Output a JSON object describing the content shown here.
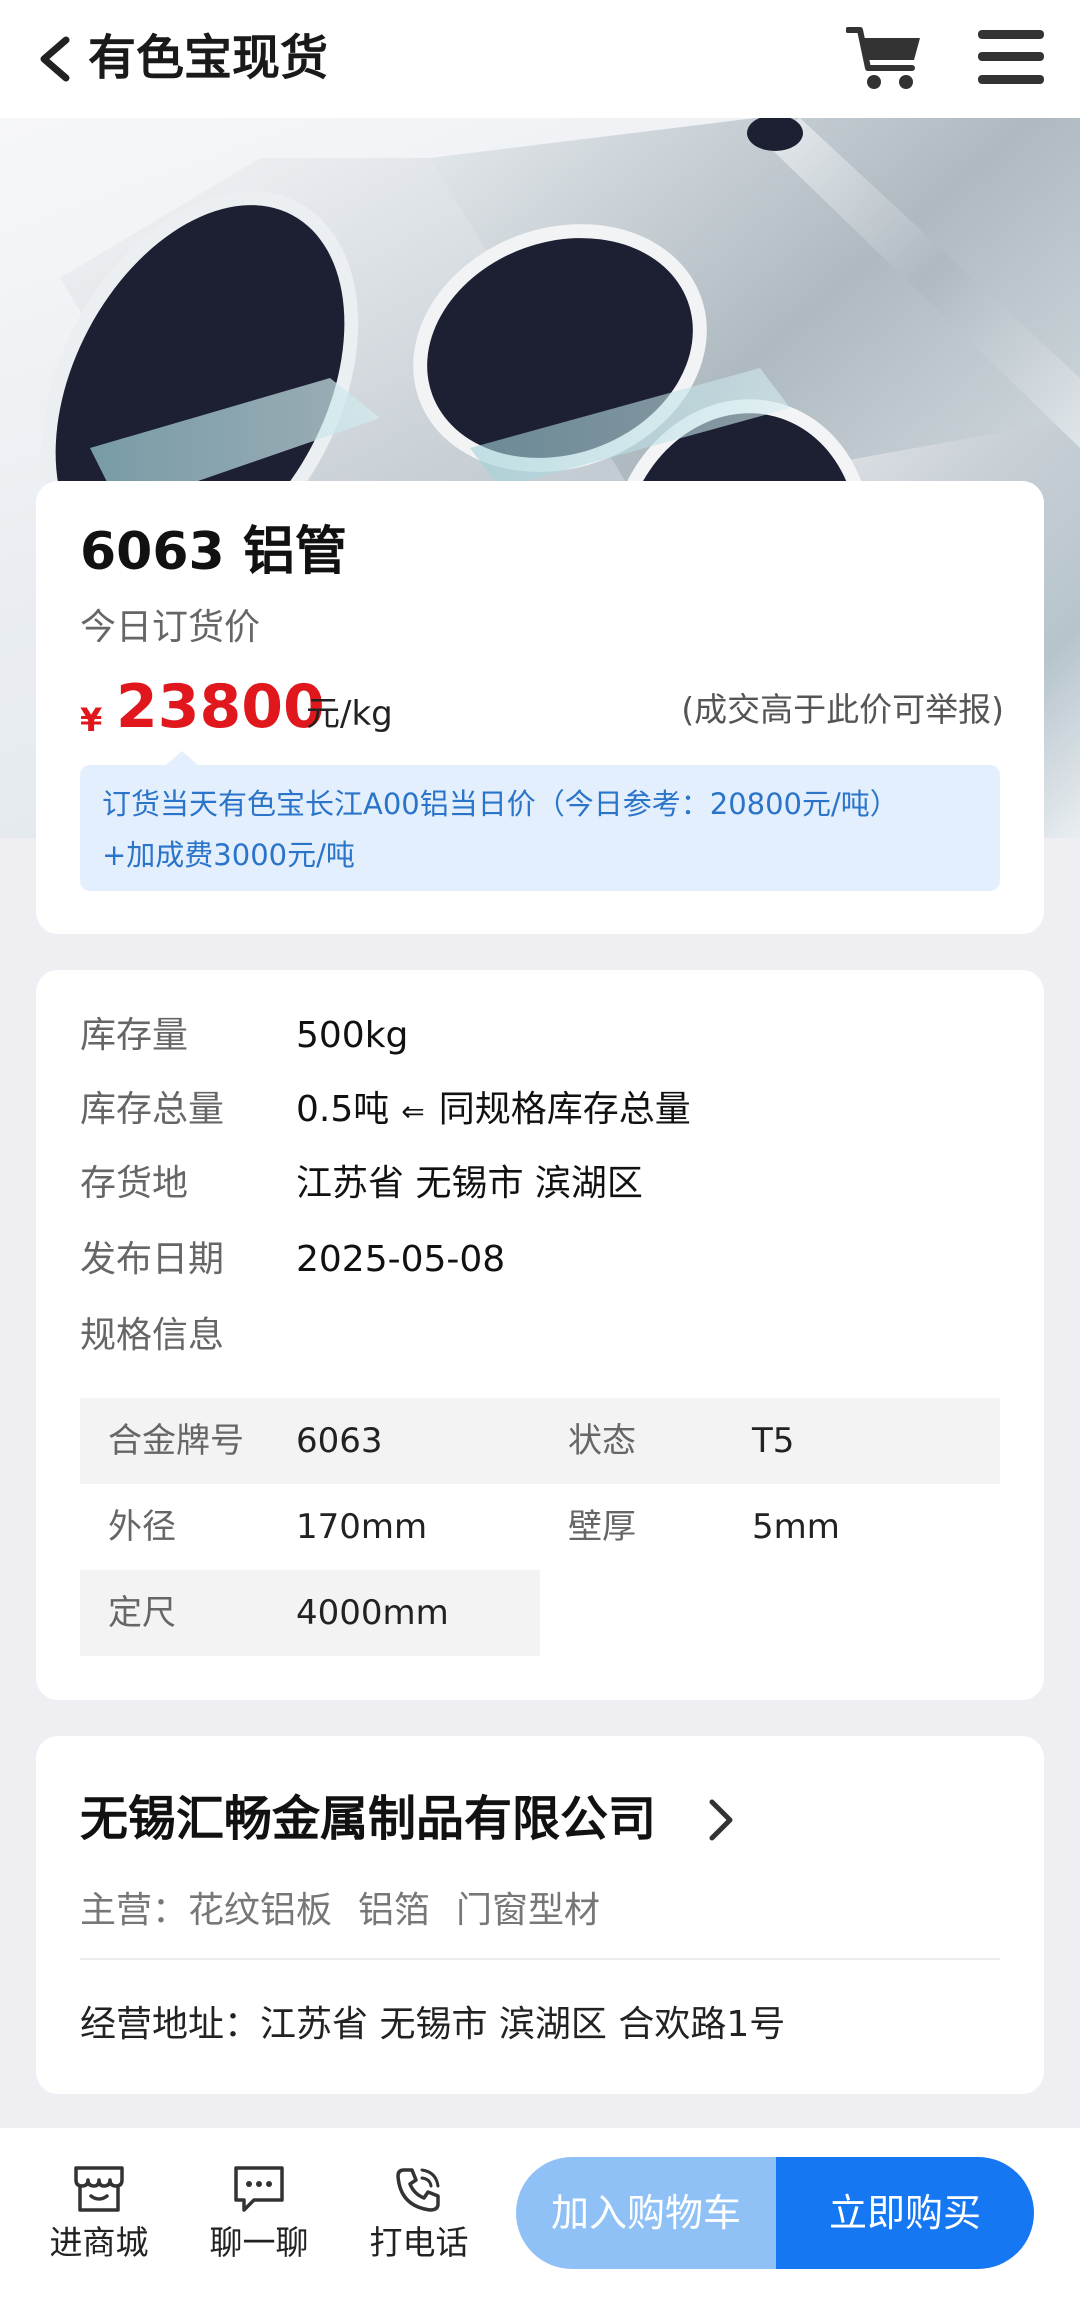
{
  "header": {
    "title": "有色宝现货"
  },
  "icons": {
    "back": "chevron-left-icon",
    "cart": "cart-icon",
    "menu": "hamburger-menu-icon"
  },
  "product": {
    "name": "6063 铝管",
    "price_label": "今日订货价",
    "currency": "¥",
    "price": "23800",
    "unit": "元/kg",
    "report_note": "(成交高于此价可举报)",
    "info_line1": "订货当天有色宝长江A00铝当日价（今日参考：20800元/吨）",
    "info_line2": "+加成费3000元/吨"
  },
  "details": {
    "stock_label": "库存量",
    "stock_value": "500kg",
    "total_label": "库存总量",
    "total_value": "0.5吨",
    "total_arrow": "⇐",
    "total_note": "同规格库存总量",
    "location_label": "存货地",
    "location_value": "江苏省 无锡市 滨湖区",
    "date_label": "发布日期",
    "date_value": "2025-05-08",
    "spec_label": "规格信息"
  },
  "specs": {
    "alloy_label": "合金牌号",
    "alloy_value": "6063",
    "state_label": "状态",
    "state_value": "T5",
    "od_label": "外径",
    "od_value": "170mm",
    "wall_label": "壁厚",
    "wall_value": "5mm",
    "length_label": "定尺",
    "length_value": "4000mm"
  },
  "company": {
    "name": "无锡汇畅金属制品有限公司",
    "business_label": "主营：",
    "business_items": [
      "花纹铝板",
      "铝箔",
      "门窗型材"
    ],
    "address": "经营地址：江苏省 无锡市 滨湖区 合欢路1号"
  },
  "bottom_nav": {
    "store": "进商城",
    "chat": "聊一聊",
    "call": "打电话",
    "add_cart": "加入购物车",
    "buy_now": "立即购买"
  },
  "colors": {
    "price_red": "#e0171c",
    "primary_blue": "#1677f2",
    "light_blue": "#8fc1f7",
    "info_bg": "#e4effd",
    "info_text": "#2a74c9"
  }
}
